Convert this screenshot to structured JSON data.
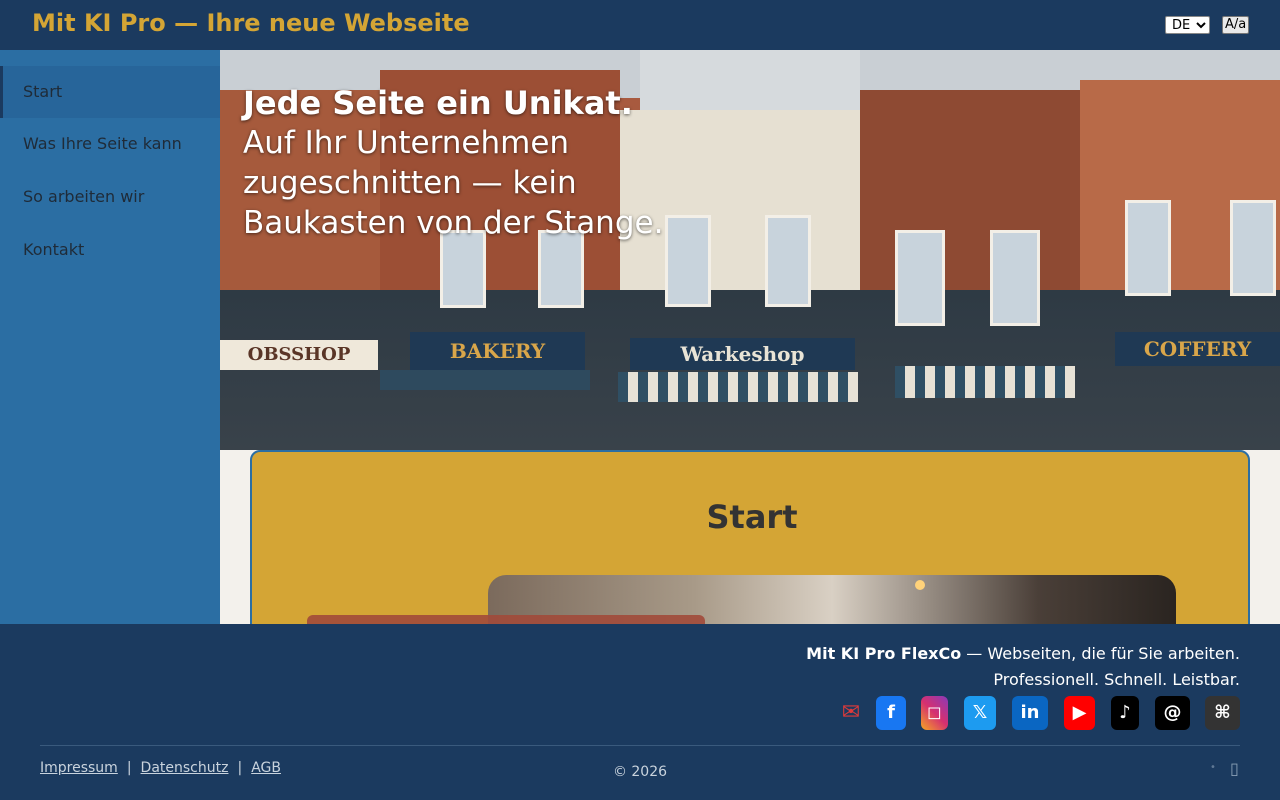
{
  "header": {
    "title": "Mit KI Pro — Ihre neue Webseite",
    "language": "DE",
    "font_toggle": "A/a"
  },
  "sidebar": {
    "items": [
      {
        "label": "Start",
        "active": true
      },
      {
        "label": "Was Ihre Seite kann"
      },
      {
        "label": "So arbeiten wir"
      },
      {
        "label": "Kontakt"
      }
    ]
  },
  "hero": {
    "headline": "Jede Seite ein Unikat.",
    "sub": "Auf Ihr Unternehmen zugeschnitten — kein Baukasten von der Stange.",
    "shop_signs": [
      "OBSSHOP",
      "BAKERY",
      "Warkeshop",
      "COFFERY"
    ]
  },
  "main": {
    "section_title": "Start"
  },
  "footer": {
    "brand": "Mit KI Pro FlexCo",
    "tagline_rest": " — Webseiten, die für Sie arbeiten.",
    "tagline_line2": "Professionell. Schnell. Leistbar.",
    "social": [
      {
        "name": "email-icon",
        "glyph": "✉",
        "color": "#e03a3a"
      },
      {
        "name": "facebook-icon",
        "glyph": "f",
        "color": "#1877f2"
      },
      {
        "name": "instagram-icon",
        "glyph": "◻",
        "color": "#d6306f"
      },
      {
        "name": "x-twitter-icon",
        "glyph": "𝕏",
        "color": "#1d9bf0"
      },
      {
        "name": "linkedin-icon",
        "glyph": "in",
        "color": "#0a66c2"
      },
      {
        "name": "youtube-icon",
        "glyph": "▶",
        "color": "#ff0000"
      },
      {
        "name": "tiktok-icon",
        "glyph": "♪",
        "color": "#000000"
      },
      {
        "name": "threads-icon",
        "glyph": "@",
        "color": "#000000"
      },
      {
        "name": "command-icon",
        "glyph": "⌘",
        "color": "#333333"
      }
    ],
    "links": [
      "Impressum",
      "Datenschutz",
      "AGB"
    ],
    "copyright": "© 2026"
  },
  "colors": {
    "header_bg": "#1b3a5f",
    "accent_gold": "#d4a535",
    "sidebar_bg": "#2b6ea3"
  }
}
